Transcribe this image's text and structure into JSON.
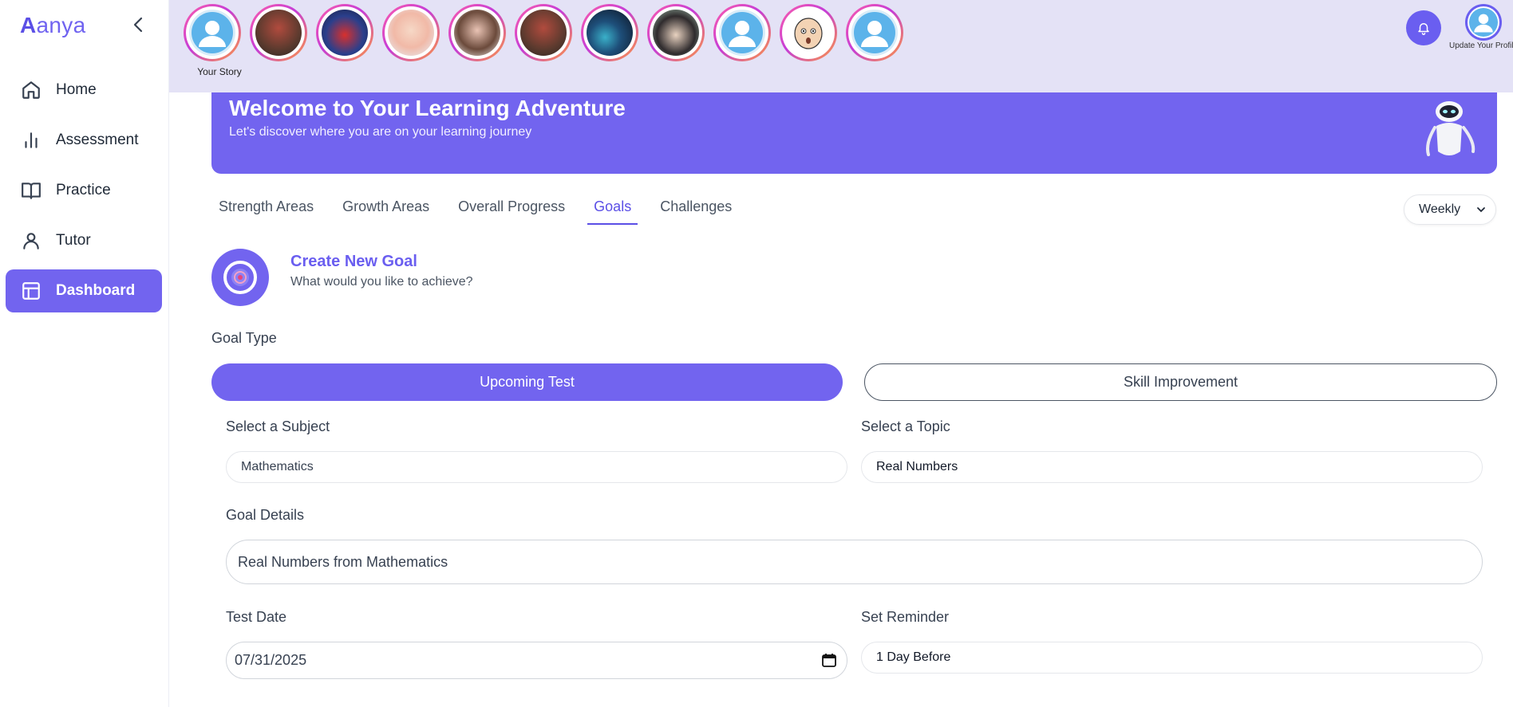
{
  "brand": {
    "first_letter": "A",
    "rest": "anya"
  },
  "sidebar": {
    "items": [
      {
        "label": "Home",
        "icon": "home-icon",
        "active": false
      },
      {
        "label": "Assessment",
        "icon": "bar-chart-icon",
        "active": false
      },
      {
        "label": "Practice",
        "icon": "book-open-icon",
        "active": false
      },
      {
        "label": "Tutor",
        "icon": "user-icon",
        "active": false
      },
      {
        "label": "Dashboard",
        "icon": "layout-icon",
        "active": true
      }
    ]
  },
  "topbar": {
    "your_story_label": "Your Story",
    "stories_count": 11,
    "profile_label": "Update Your Profile"
  },
  "banner": {
    "title": "Welcome to Your Learning Adventure",
    "subtitle": "Let's discover where you are on your learning journey"
  },
  "tabs": [
    {
      "label": "Strength Areas",
      "active": false
    },
    {
      "label": "Growth Areas",
      "active": false
    },
    {
      "label": "Overall Progress",
      "active": false
    },
    {
      "label": "Goals",
      "active": true
    },
    {
      "label": "Challenges",
      "active": false
    }
  ],
  "period_select": {
    "value": "Weekly"
  },
  "goal": {
    "title": "Create New Goal",
    "subtitle": "What would you like to achieve?",
    "goal_type_label": "Goal Type",
    "type_options": [
      "Upcoming Test",
      "Skill Improvement"
    ],
    "selected_type": "Upcoming Test",
    "subject_label": "Select a Subject",
    "subject_value": "Mathematics",
    "topic_label": "Select a Topic",
    "topic_value": "Real Numbers",
    "details_label": "Goal Details",
    "details_value": "Real Numbers from Mathematics",
    "test_date_label": "Test Date",
    "test_date_value": "07/31/2025",
    "reminder_label": "Set Reminder",
    "reminder_value": "1 Day Before"
  },
  "colors": {
    "accent": "#7264ef",
    "topbar_bg": "#e4e2f6",
    "story_ring": "#d63fd0"
  }
}
